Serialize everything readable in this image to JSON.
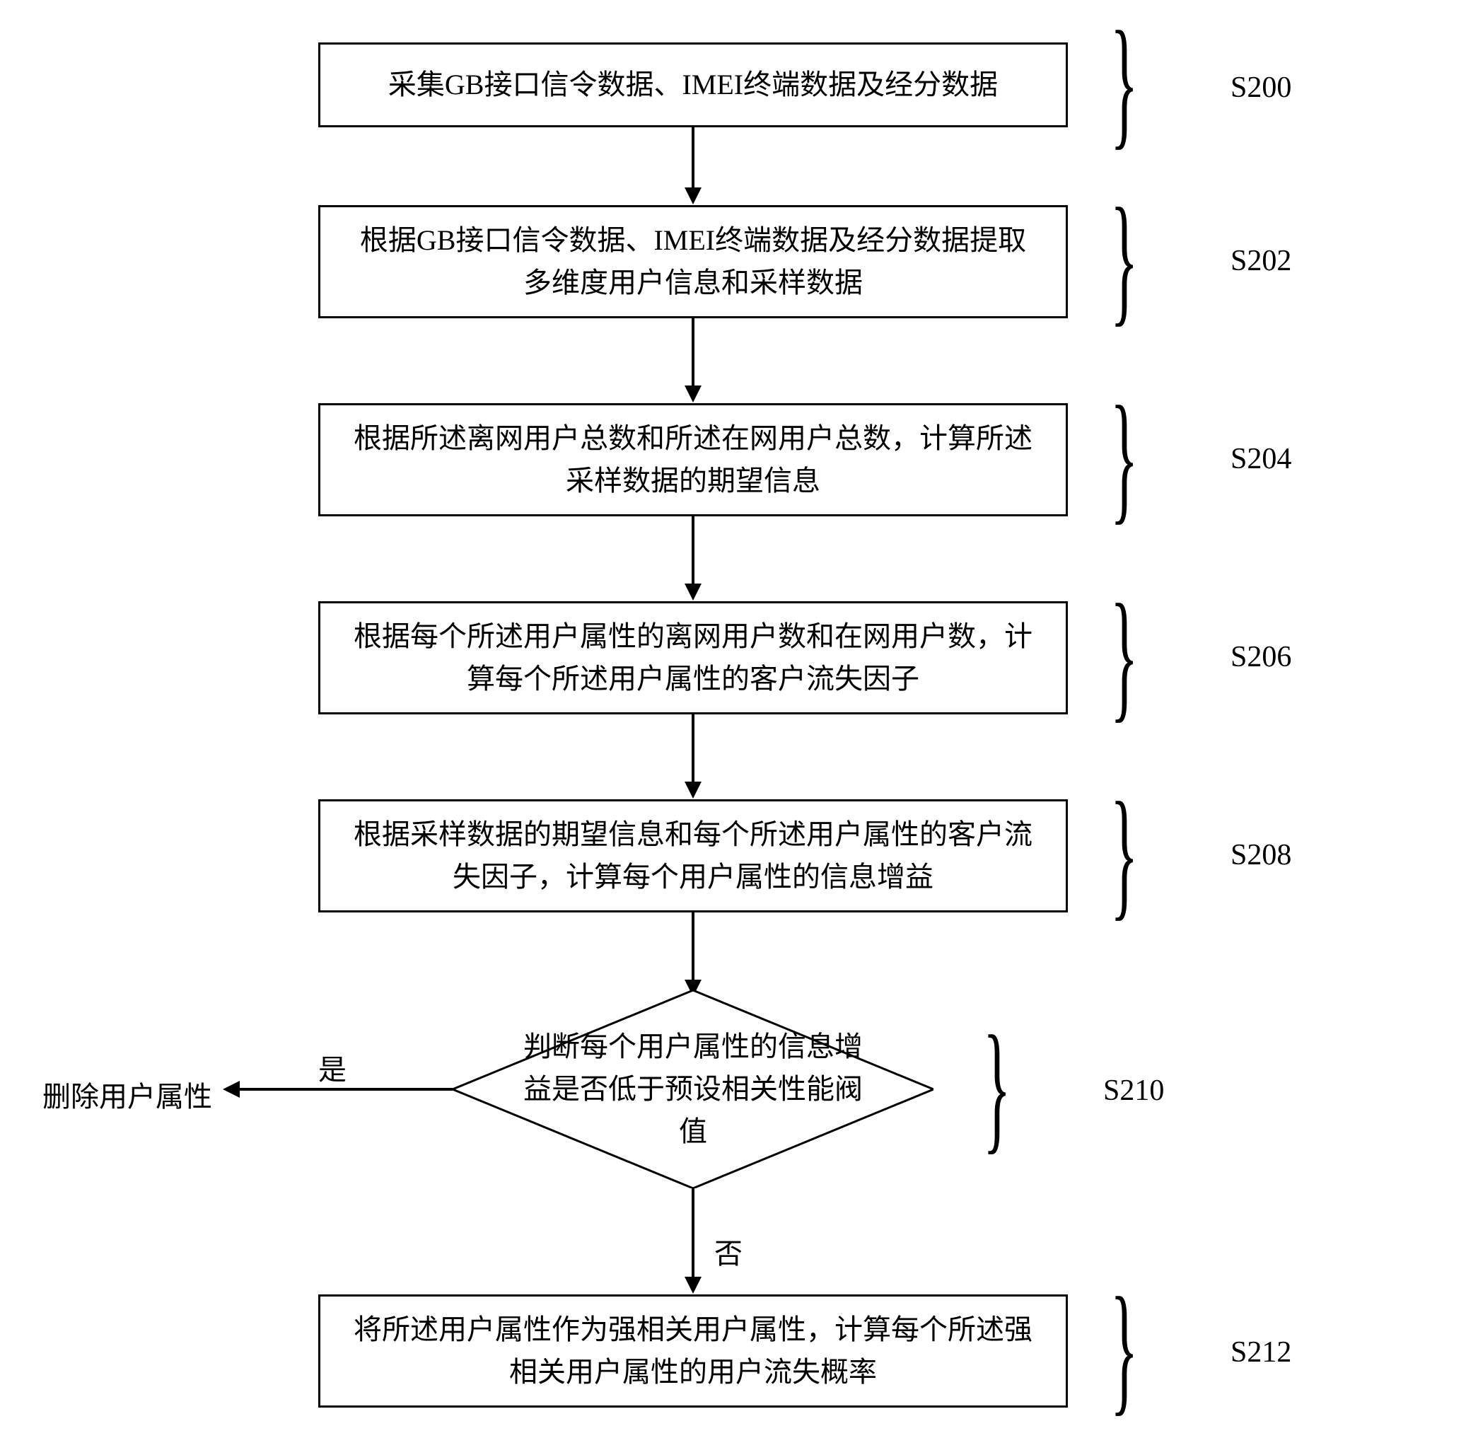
{
  "steps": {
    "s200": {
      "label": "S200",
      "text": "采集GB接口信令数据、IMEI终端数据及经分数据"
    },
    "s202": {
      "label": "S202",
      "text": "根据GB接口信令数据、IMEI终端数据及经分数据提取多维度用户信息和采样数据"
    },
    "s204": {
      "label": "S204",
      "text": "根据所述离网用户总数和所述在网用户总数，计算所述采样数据的期望信息"
    },
    "s206": {
      "label": "S206",
      "text": "根据每个所述用户属性的离网用户数和在网用户数，计算每个所述用户属性的客户流失因子"
    },
    "s208": {
      "label": "S208",
      "text": "根据采样数据的期望信息和每个所述用户属性的客户流失因子，计算每个用户属性的信息增益"
    },
    "s210": {
      "label": "S210",
      "text": "判断每个用户属性的信息增益是否低于预设相关性能阀值"
    },
    "s212": {
      "label": "S212",
      "text": "将所述用户属性作为强相关用户属性，计算每个所述强相关用户属性的用户流失概率"
    }
  },
  "edges": {
    "yes": "是",
    "no": "否"
  },
  "side_action": "删除用户属性"
}
